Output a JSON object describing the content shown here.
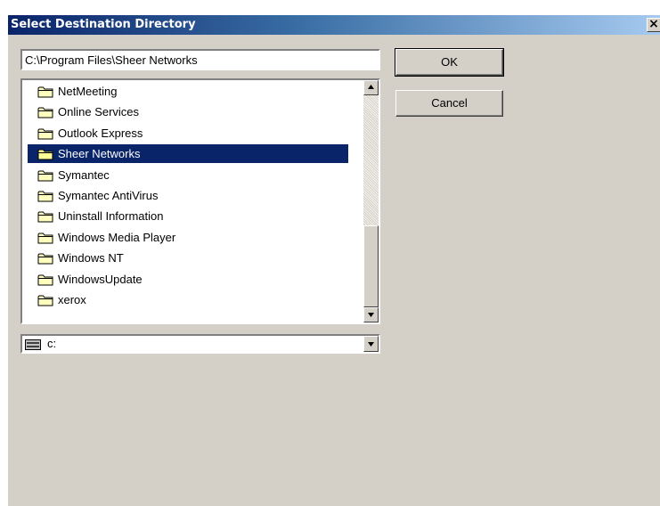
{
  "window": {
    "title": "Select Destination Directory",
    "close_glyph": "×",
    "colors": {
      "face": "#d4d0c8",
      "title_start": "#0a246a",
      "title_end": "#a6caf0",
      "selection": "#0a246a"
    }
  },
  "path": {
    "value": "C:\\Program Files\\Sheer Networks"
  },
  "folders": [
    {
      "label": "NetMeeting",
      "selected": false
    },
    {
      "label": "Online Services",
      "selected": false
    },
    {
      "label": "Outlook Express",
      "selected": false
    },
    {
      "label": "Sheer Networks",
      "selected": true
    },
    {
      "label": "Symantec",
      "selected": false
    },
    {
      "label": "Symantec AntiVirus",
      "selected": false
    },
    {
      "label": "Uninstall Information",
      "selected": false
    },
    {
      "label": "Windows Media Player",
      "selected": false
    },
    {
      "label": "Windows NT",
      "selected": false
    },
    {
      "label": "WindowsUpdate",
      "selected": false
    },
    {
      "label": "xerox",
      "selected": false
    }
  ],
  "drive": {
    "label": "c:",
    "icon": "hard-drive-icon"
  },
  "buttons": {
    "ok": "OK",
    "cancel": "Cancel"
  },
  "icons": {
    "folder": "folder-icon",
    "scroll_up": "arrow-up-icon",
    "scroll_down": "arrow-down-icon",
    "dropdown": "chevron-down-icon"
  }
}
